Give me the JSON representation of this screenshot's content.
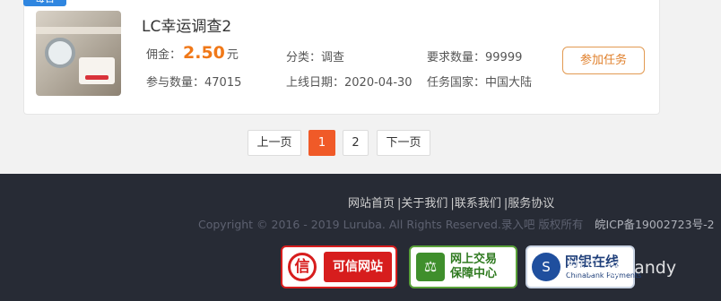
{
  "task": {
    "badge": "每日",
    "title": "LC幸运调查2",
    "commission_label": "佣金：",
    "commission_value": "2.50",
    "commission_unit": "元",
    "category": "分类：调查",
    "required_count": "要求数量：99999",
    "participants": "参与数量：47015",
    "online_date": "上线日期：2020-04-30",
    "country": "任务国家：中国大陆",
    "join_button": "参加任务"
  },
  "pagination": {
    "prev": "上一页",
    "pages": [
      "1",
      "2"
    ],
    "active_page": "1",
    "next": "下一页"
  },
  "footer": {
    "links": [
      "网站首页",
      "关于我们",
      "联系我们",
      "服务协议"
    ],
    "copyright": "Copyright © 2016 - 2019 Luruba. All Rights Reserved.录入吧 版权所有",
    "icp": "皖ICP备19002723号-2",
    "badges": {
      "credible": {
        "icon": "信",
        "label": "可信网站"
      },
      "trade": {
        "line1": "网上交易",
        "line2": "保障中心"
      },
      "chinabank": {
        "main": "网银在线",
        "sub": "Chinabank Payments"
      }
    },
    "watermark": "知乎 @Sandy"
  }
}
